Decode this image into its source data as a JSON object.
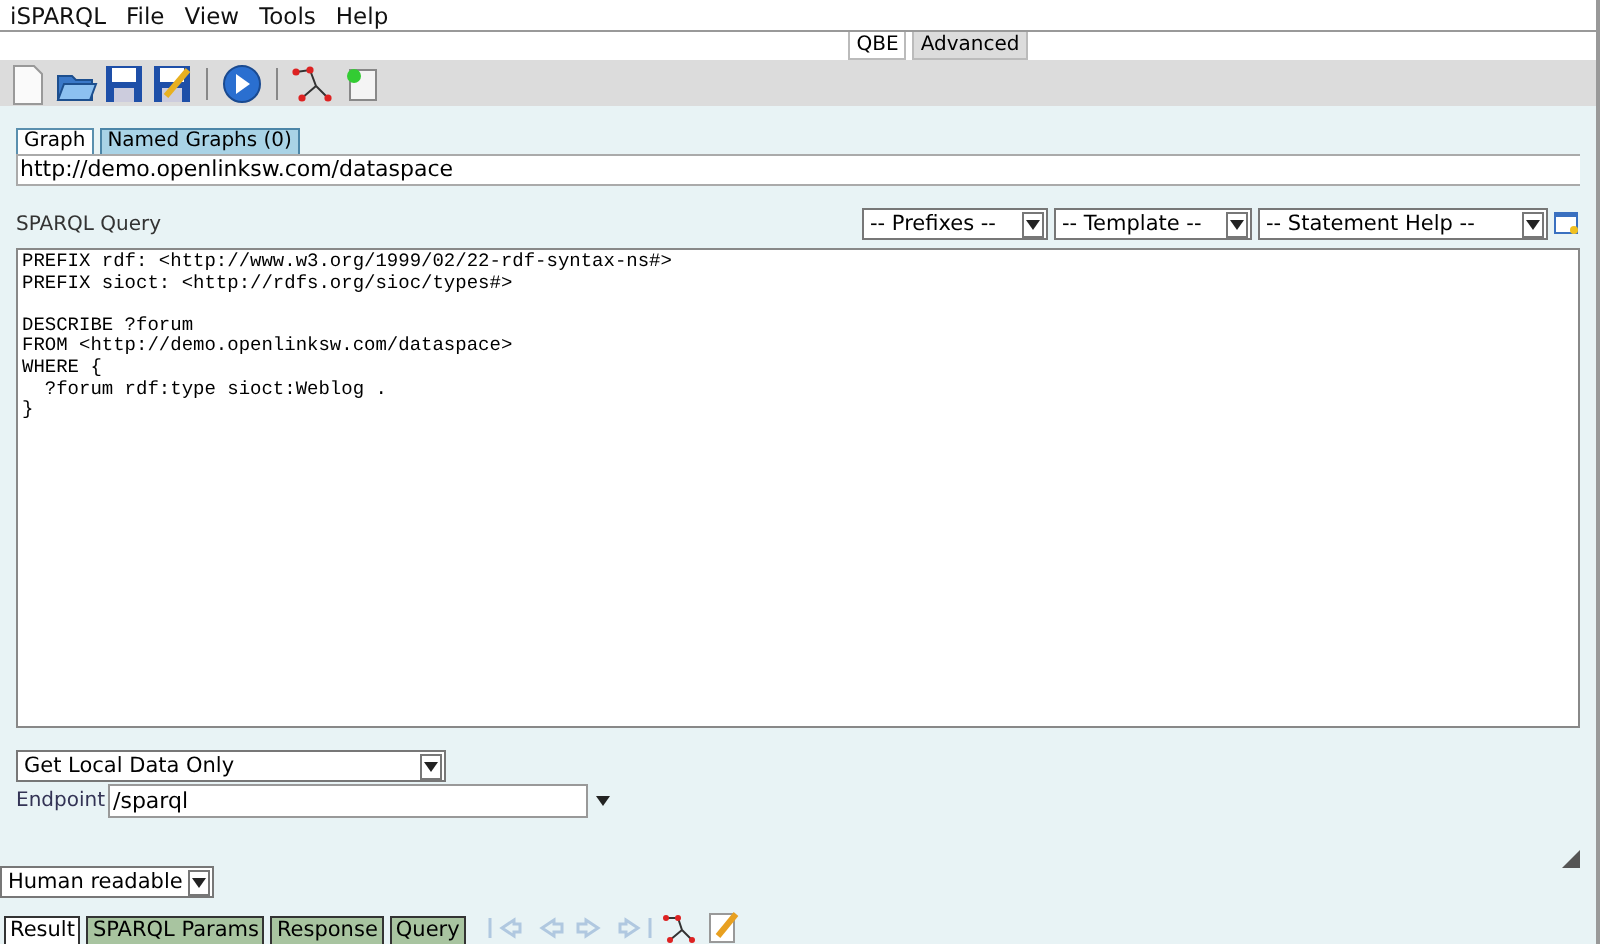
{
  "menu": [
    "iSPARQL",
    "File",
    "View",
    "Tools",
    "Help"
  ],
  "mode_tabs": [
    {
      "label": "QBE",
      "selected": false
    },
    {
      "label": "Advanced",
      "selected": true
    }
  ],
  "toolbar": [
    {
      "kind": "new"
    },
    {
      "kind": "open"
    },
    {
      "kind": "save"
    },
    {
      "kind": "saveas"
    },
    {
      "kind": "sep"
    },
    {
      "kind": "run"
    },
    {
      "kind": "sep"
    },
    {
      "kind": "graph"
    },
    {
      "kind": "load"
    }
  ],
  "graph_tabs": [
    {
      "label": "Graph",
      "selected": true
    },
    {
      "label": "Named Graphs (0)",
      "selected": false
    }
  ],
  "graph_uri": "http://demo.openlinksw.com/dataspace",
  "query_label": "SPARQL Query",
  "query_selects": [
    "-- Prefixes --",
    "-- Template --",
    "-- Statement Help --"
  ],
  "query": "PREFIX rdf: <http://www.w3.org/1999/02/22-rdf-syntax-ns#>\nPREFIX sioct: <http://rdfs.org/sioc/types#>\n\nDESCRIBE ?forum\nFROM <http://demo.openlinksw.com/dataspace>\nWHERE {\n  ?forum rdf:type sioct:Weblog .\n}",
  "data_source": "Get Local Data Only",
  "endpoint": {
    "label": "Endpoint",
    "value": "/sparql"
  },
  "format": "Human readable",
  "result_tabs": [
    {
      "label": "Result",
      "selected": true
    },
    {
      "label": "SPARQL Params",
      "selected": false
    },
    {
      "label": "Response",
      "selected": false
    },
    {
      "label": "Query",
      "selected": false
    }
  ],
  "result_nav": [
    {
      "kind": "first",
      "disabled": true
    },
    {
      "kind": "prev",
      "disabled": true
    },
    {
      "kind": "next",
      "disabled": true
    },
    {
      "kind": "last",
      "disabled": true
    },
    {
      "kind": "graph",
      "disabled": false
    },
    {
      "kind": "edit",
      "disabled": false
    }
  ]
}
